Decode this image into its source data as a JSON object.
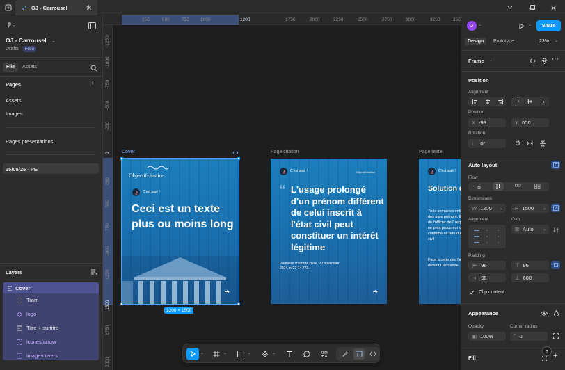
{
  "window": {
    "tab_title": "OJ - Carrousel",
    "new_tab": "+"
  },
  "file": {
    "name": "OJ - Carrousel",
    "status": "Drafts",
    "plan_badge": "Free",
    "tabs": [
      "File",
      "Assets"
    ]
  },
  "pages": {
    "heading": "Pages",
    "items": [
      "Assets",
      "Images",
      "Pages presentations",
      "25/05/25 - PE"
    ]
  },
  "layers": {
    "heading": "Layers",
    "items": [
      "Cover",
      "Tram",
      "logo",
      "Titre + surtitre",
      "icones/arrow",
      "image-covers"
    ]
  },
  "rulers": {
    "h_ticks": [
      "250",
      "500",
      "750",
      "1000",
      "1200",
      "1750",
      "2000",
      "2250",
      "2500",
      "2750",
      "3000",
      "3250",
      "3500"
    ],
    "v_ticks": [
      "-1250",
      "-1000",
      "-750",
      "-500",
      "-250",
      "0",
      "250",
      "500",
      "750",
      "1000",
      "1250",
      "1500",
      "1750",
      "2000"
    ]
  },
  "frames": {
    "cover": {
      "label": "Cover",
      "brand": "Objectif-Justice",
      "kicker": "C'est jugé !",
      "title": "Ceci est un texte plus ou moins long",
      "size": "1200 × 1500"
    },
    "citation": {
      "label": "Page citation",
      "kicker": "C'est jugé !",
      "brand": "Objectif-Justice",
      "quote_mark": "“",
      "quote": "L'usage prolongé d'un prénom différent de celui inscrit à l'état civil peut constituer un intérêt légitime",
      "source": "Première chambre civile, 20 novembre 2024, n°22-14.773."
    },
    "texte": {
      "label": "Page texte",
      "kicker": "C'est jugé !",
      "title": "Solution de cassation",
      "p1": "Trois semaines enfant, des pare prénom. Ils ont de l'officier de l' requête ne prés procureur de la confirmé ce refu du code civil",
      "p2": "Face à cette déc l'affaire devant l demande."
    }
  },
  "right": {
    "avatar": "J",
    "share": "Share",
    "tabs": [
      "Design",
      "Prototype"
    ],
    "zoom": "23%",
    "frame_label": "Frame",
    "position": {
      "title": "Position",
      "alignment": "Alignment",
      "position_label": "Position",
      "x_prefix": "X",
      "x": "-99",
      "y_prefix": "Y",
      "y": "606",
      "rotation_label": "Rotation",
      "rotation": "0°"
    },
    "autolayout": {
      "title": "Auto layout",
      "flow": "Flow",
      "dimensions": "Dimensions",
      "w_prefix": "W",
      "w": "1200",
      "h_prefix": "H",
      "h": "1500",
      "alignment": "Alignment",
      "gap_label": "Gap",
      "gap": "Auto",
      "padding": "Padding",
      "pad_left": "96",
      "pad_top": "96",
      "pad_right": "96",
      "pad_bottom": "600",
      "clip": "Clip content"
    },
    "appearance": {
      "title": "Appearance",
      "opacity_label": "Opacity",
      "opacity": "100%",
      "radius_label": "Corner radius",
      "radius": "0"
    },
    "fill": {
      "title": "Fill"
    },
    "help": "?"
  },
  "colors": {
    "accent": "#0d99ff",
    "frame_blue": "#1c7fbd",
    "selection": "#4a4f8a",
    "canvas": "#1e1e1e",
    "panel": "#2c2c2c"
  }
}
